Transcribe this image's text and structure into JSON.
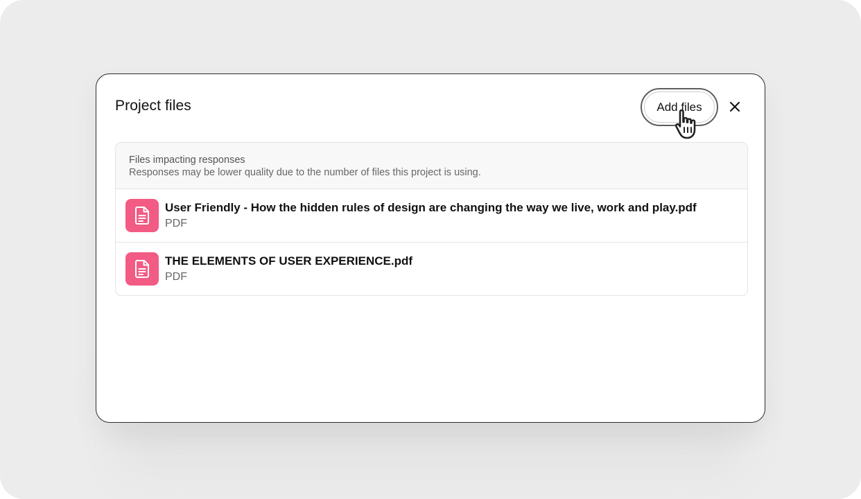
{
  "dialog": {
    "title": "Project files",
    "add_files_label": "Add files",
    "close_icon": "close-icon"
  },
  "notice": {
    "title": "Files impacting responses",
    "text": "Responses may be lower quality due to the number of files this project is using."
  },
  "files": [
    {
      "name": "User Friendly - How the hidden rules of design are changing the way we live, work and play.pdf",
      "type": "PDF",
      "icon": "document-icon"
    },
    {
      "name": "THE ELEMENTS OF USER EXPERIENCE.pdf",
      "type": "PDF",
      "icon": "document-icon"
    }
  ],
  "colors": {
    "file_icon_bg": "#f25b84",
    "backdrop": "#ececec"
  }
}
